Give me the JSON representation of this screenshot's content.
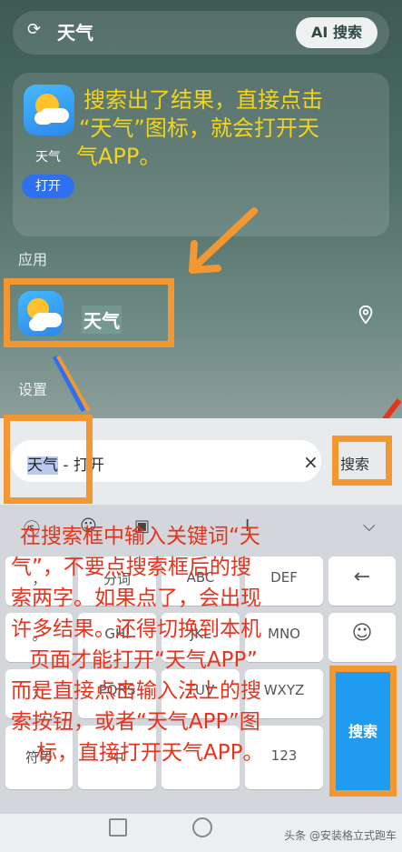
{
  "search": {
    "query": "天气",
    "ai_button": "AI 搜索"
  },
  "card": {
    "app_label": "天气",
    "open_button": "打开",
    "annotation": [
      "搜索出了结果，直接点击",
      "“天气”图标，就会打开天",
      "气APP。"
    ]
  },
  "sections": {
    "apps": "应用",
    "settings": "设置"
  },
  "app_result": {
    "name": "天气"
  },
  "input_bar": {
    "highlight": "天气",
    "suffix": " - 打开",
    "clear": "×",
    "search_label": "搜索"
  },
  "keyboard": {
    "top_icons": [
      "smile-icon",
      "clipboard-icon",
      "cursor-icon",
      "collapse-icon"
    ],
    "keys": {
      "k1": "分词",
      "k2": "ABC",
      "k3": "DEF",
      "k4": "GHI",
      "k5": "JKL",
      "k6": "MNO",
      "k7": "PQRS",
      "k8": "TUV",
      "k9": "WXYZ",
      "sym": "符号",
      "num": "123"
    },
    "enter_label": "搜索"
  },
  "annotation_red": [
    "在搜索框中输入关键词“天",
    "气”，不要点搜索框后的搜",
    "索两字。如果点了，会出现",
    "许多结果。还得切换到本机",
    "页面才能打开“天气APP”",
    "而是直接点击输入法上的搜",
    "索按钮，或者“天气APP”图",
    "标，直接打开天气APP。"
  ],
  "watermark": "头条 @安装格立式跑车",
  "colors": {
    "accent_orange": "#f39733",
    "annotation_yellow": "#f4d417",
    "annotation_red": "#e8331c",
    "enter_blue": "#1f9cf0"
  }
}
